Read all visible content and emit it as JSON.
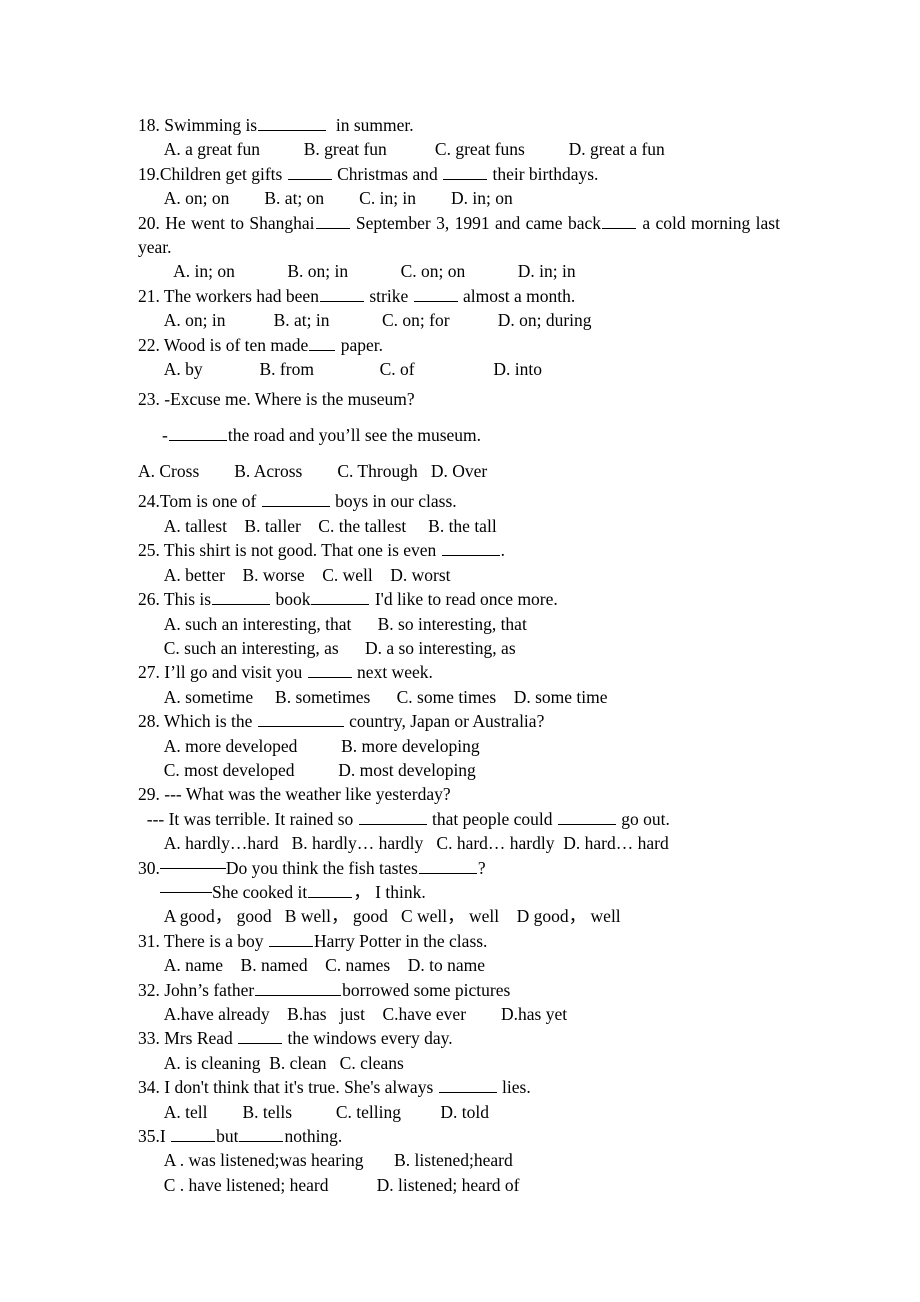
{
  "document": {
    "type": "english-grammar-worksheet",
    "question_range": "18-35"
  },
  "questions": {
    "q18": {
      "stem_a": "18. Swimming is",
      "stem_b": "  in summer.",
      "options": "  A. a great fun          B. great fun           C. great funs          D. great a fun"
    },
    "q19": {
      "stem_a": "19.Children get gifts ",
      "stem_b": " Christmas and ",
      "stem_c": " their birthdays.",
      "options": "  A. on; on        B. at; on        C. in; in        D. in; on"
    },
    "q20": {
      "stem_a": "20. He went to Shanghai",
      "stem_b": " September 3, 1991 and came back",
      "stem_c": " a cold morning last year.",
      "options": "   A. in; on            B. on; in            C. on; on            D. in; in"
    },
    "q21": {
      "stem_a": "21. The workers had been",
      "stem_b": " strike ",
      "stem_c": " almost a month.",
      "options": "  A. on; in           B. at; in            C. on; for           D. on; during"
    },
    "q22": {
      "stem_a": "22. Wood is of ten made",
      "stem_b": " paper.",
      "options": "  A. by             B. from               C. of                  D. into"
    },
    "q23": {
      "stem": "23. -Excuse me. Where is the museum?",
      "reply_a": "-",
      "reply_b": "the road and you’ll see the museum.",
      "options": "A. Cross        B. Across        C. Through   D. Over"
    },
    "q24": {
      "stem_a": "24.Tom is one of ",
      "stem_b": " boys in our class.",
      "options": "  A. tallest    B. taller    C. the tallest     B. the tall"
    },
    "q25": {
      "stem_a": "25. This shirt is not good. That one is even ",
      "stem_b": ".",
      "options": "  A. better    B. worse    C. well    D. worst"
    },
    "q26": {
      "stem_a": "26. This is",
      "stem_b": " book",
      "stem_c": " I'd like to read once more.",
      "options_1": "  A. such an interesting, that      B. so interesting, that",
      "options_2": "  C. such an interesting, as      D. a so interesting, as"
    },
    "q27": {
      "stem_a": "27. I’ll go and visit you ",
      "stem_b": " next week.",
      "options": "  A. sometime     B. sometimes      C. some times    D. some time"
    },
    "q28": {
      "stem_a": "28. Which is the ",
      "stem_b": " country, Japan or Australia?",
      "options_1": "  A. more developed          B. more developing",
      "options_2": "  C. most developed          D. most developing"
    },
    "q29": {
      "stem": "29. --- What was the weather like yesterday?",
      "reply_a": "  --- It was terrible. It rained so ",
      "reply_b": " that people could ",
      "reply_c": " go out.",
      "options": "  A. hardly…hard   B. hardly… hardly   C. hard… hardly  D. hard… hard"
    },
    "q30": {
      "stem_a": "30.",
      "stem_b": "Do you think the fish tastes",
      "stem_c": "?",
      "reply_a": "She cooked it",
      "reply_b": "， I think.",
      "options": "  A good， good   B well， good   C well， well    D good， well"
    },
    "q31": {
      "stem_a": "31. There is a boy ",
      "stem_b": "Harry Potter in the class.",
      "options": "  A. name    B. named    C. names    D. to name"
    },
    "q32": {
      "stem_a": "32. John’s father",
      "stem_b": "borrowed some pictures",
      "options": "  A.have already    B.has   just    C.have ever        D.has yet"
    },
    "q33": {
      "stem_a": "33. Mrs Read ",
      "stem_b": " the windows every day.",
      "options": "  A. is cleaning  B. clean   C. cleans"
    },
    "q34": {
      "stem_a": "34. I don't think that it's true. She's always ",
      "stem_b": " lies.",
      "options": "  A. tell        B. tells          C. telling         D. told"
    },
    "q35": {
      "stem_a": "35.I ",
      "stem_b": "but",
      "stem_c": "nothing.",
      "options_1": "  A . was listened;was hearing       B. listened;heard",
      "options_2": "  C . have listened; heard           D. listened; heard of"
    }
  }
}
